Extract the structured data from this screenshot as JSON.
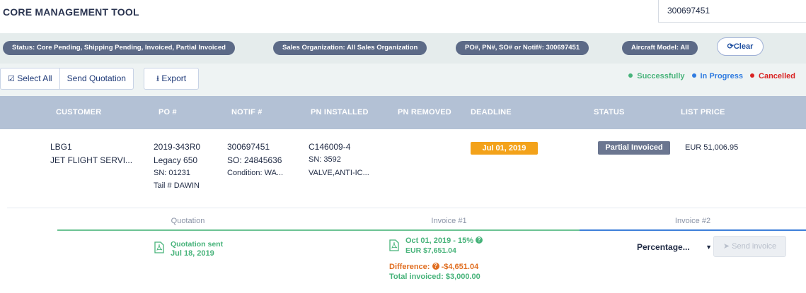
{
  "app": {
    "title": "CORE MANAGEMENT TOOL"
  },
  "search": {
    "value": "300697451"
  },
  "filters": [
    {
      "label": "Status: Core Pending, Shipping Pending, Invoiced, Partial Invoiced"
    },
    {
      "label": "Sales Organization: All Sales Organization"
    },
    {
      "label": "PO#, PN#, SO# or Notif#: 300697451"
    },
    {
      "label": "Aircraft Model: All"
    }
  ],
  "clear": {
    "label": "Clear",
    "icon": "refresh-icon"
  },
  "toolbar": {
    "select_all": "Select All",
    "send_quotation": "Send Quotation",
    "export": "Export"
  },
  "legend": {
    "successfully": {
      "label": "Successfully",
      "color": "#47b37a"
    },
    "in_progress": {
      "label": "In Progress",
      "color": "#2f7be0"
    },
    "cancelled": {
      "label": "Cancelled",
      "color": "#d92323"
    }
  },
  "columns": [
    "CUSTOMER",
    "PO #",
    "NOTIF #",
    "PN INSTALLED",
    "PN REMOVED",
    "DEADLINE",
    "STATUS",
    "LIST PRICE"
  ],
  "row": {
    "customer_code": "LBG1",
    "customer_name": "JET FLIGHT SERVI...",
    "po": "2019-343R0",
    "model": "Legacy 650",
    "sn": "SN: 01231",
    "tail": "Tail # DAWIN",
    "notif": "300697451",
    "so": "SO: 24845636",
    "condition": "Condition: WA...",
    "pn_installed": "C146009-4",
    "pn_sn": "SN: 3592",
    "pn_desc": "VALVE,ANTI-IC...",
    "deadline": "Jul 01, 2019",
    "status": "Partial Invoiced",
    "list_price": "EUR 51,006.95"
  },
  "steps": {
    "quotation": {
      "label": "Quotation",
      "line1": "Quotation sent",
      "line2": "Jul 18, 2019",
      "color": "#47b37a"
    },
    "invoice1": {
      "label": "Invoice #1",
      "line1": "Oct 01, 2019 - 15%",
      "line2": "EUR $7,651.04",
      "difference_label": "Difference:",
      "difference_value": "-$4,651.04",
      "total": "Total invoiced: $3,000.00",
      "color": "#47b37a"
    },
    "invoice2": {
      "label": "Invoice #2",
      "select_value": "Percentage...",
      "send_label": "Send invoice",
      "color": "#2f7be0"
    }
  }
}
